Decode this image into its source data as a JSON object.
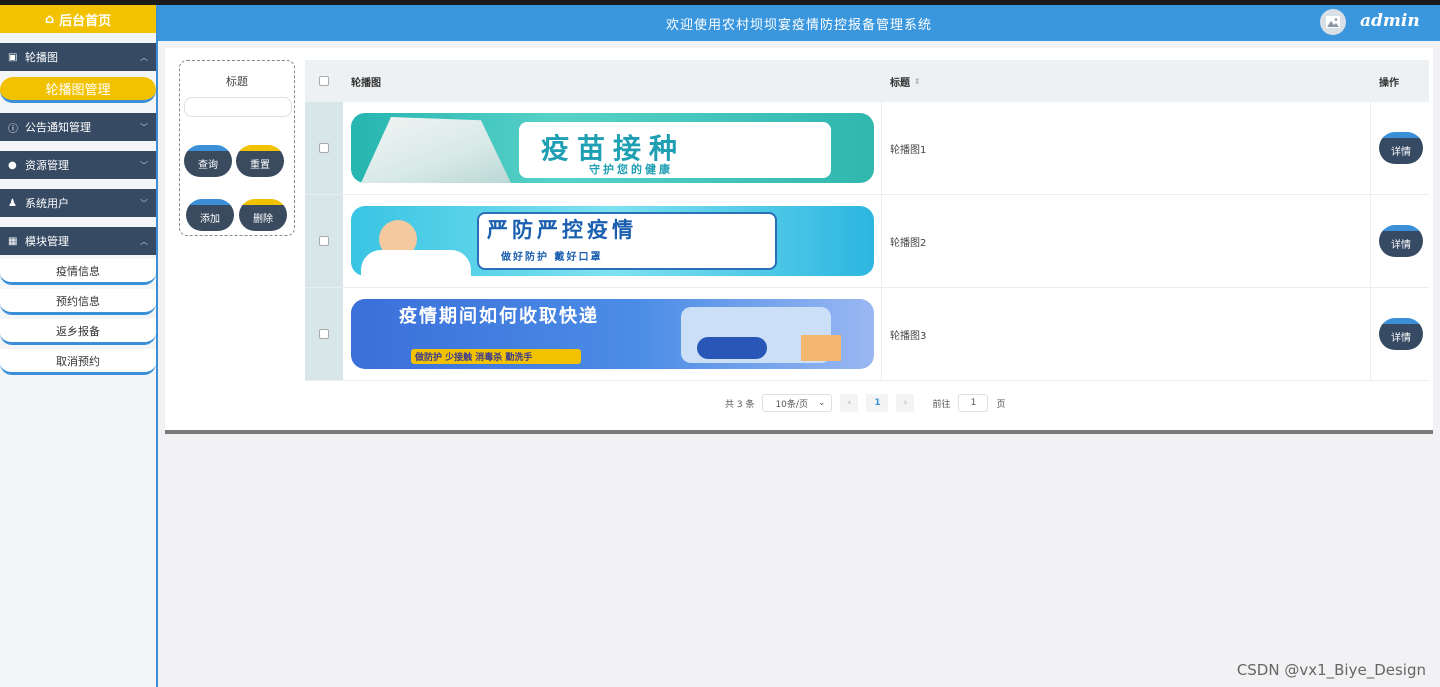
{
  "header": {
    "title": "欢迎使用农村坝坝宴疫情防控报备管理系统",
    "username": "admin"
  },
  "sidebar": {
    "home_label": "后台首页",
    "groups": [
      {
        "label": "轮播图",
        "icon": "image-icon",
        "sub": "轮播图管理"
      },
      {
        "label": "公告通知管理",
        "icon": "info-icon"
      },
      {
        "label": "资源管理",
        "icon": "location-icon"
      },
      {
        "label": "系统用户",
        "icon": "user-icon"
      },
      {
        "label": "模块管理",
        "icon": "grid-icon",
        "subs": [
          "疫情信息",
          "预约信息",
          "返乡报备",
          "取消预约"
        ]
      }
    ]
  },
  "search": {
    "label": "标题",
    "query_label": "查询",
    "reset_label": "重置",
    "add_label": "添加",
    "delete_label": "删除"
  },
  "table": {
    "columns": [
      "轮播图",
      "标题",
      "操作"
    ],
    "rows": [
      {
        "title": "轮播图1",
        "banner_main": "疫苗接种",
        "banner_sub": "守护您的健康",
        "detail_label": "详情"
      },
      {
        "title": "轮播图2",
        "banner_main": "严防严控疫情",
        "banner_sub": "做好防护 戴好口罩",
        "detail_label": "详情"
      },
      {
        "title": "轮播图3",
        "banner_main": "疫情期间如何收取快递",
        "banner_sub": "做防护 少接触 消毒杀 勤洗手",
        "detail_label": "详情"
      }
    ]
  },
  "pager": {
    "total": "共 3 条",
    "page_size": "10条/页",
    "current_page": "1",
    "goto_label": "前往",
    "goto_value": "1",
    "page_suffix": "页"
  },
  "watermark": "CSDN @vx1_Biye_Design",
  "colors": {
    "accent_blue": "#3a97dd",
    "accent_yellow": "#f2c200",
    "menu_dark": "#364a63"
  }
}
